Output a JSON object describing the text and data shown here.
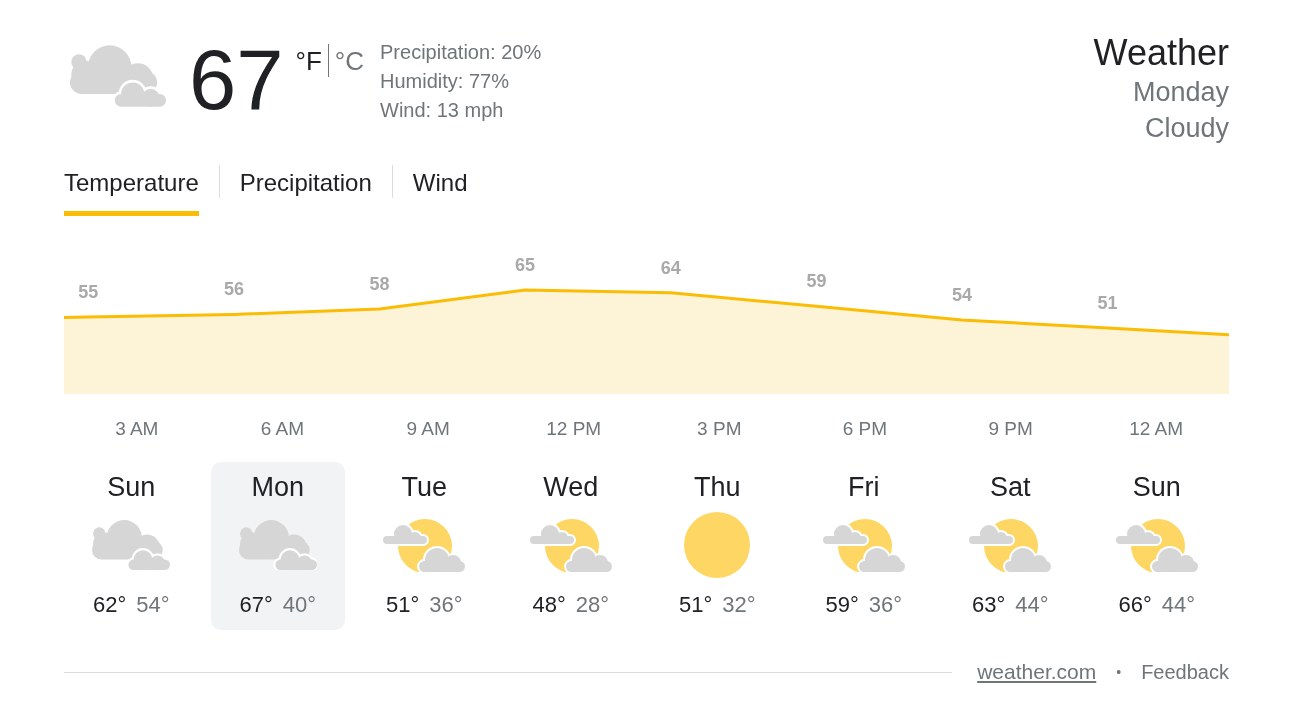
{
  "current": {
    "kind": "cloudy",
    "temperature": "67",
    "units": [
      {
        "label": "°F",
        "selected": true
      },
      {
        "label": "°C",
        "selected": false
      }
    ],
    "details": [
      "Precipitation: 20%",
      "Humidity: 77%",
      "Wind: 13 mph"
    ]
  },
  "summary": {
    "title": "Weather",
    "day": "Monday",
    "condition": "Cloudy"
  },
  "tabs": [
    {
      "label": "Temperature",
      "selected": true
    },
    {
      "label": "Precipitation",
      "selected": false
    },
    {
      "label": "Wind",
      "selected": false
    }
  ],
  "hourly": {
    "readings": [
      "55",
      "56",
      "58",
      "65",
      "64",
      "59",
      "54",
      "51"
    ],
    "times": [
      "3 AM",
      "6 AM",
      "9 AM",
      "12 PM",
      "3 PM",
      "6 PM",
      "9 PM",
      "12 AM"
    ]
  },
  "days": [
    {
      "day": "Sun",
      "kind": "cloudy",
      "high": "62°",
      "low": "54°",
      "selected": false
    },
    {
      "day": "Mon",
      "kind": "cloudy",
      "high": "67°",
      "low": "40°",
      "selected": true
    },
    {
      "day": "Tue",
      "kind": "partly_cloudy",
      "high": "51°",
      "low": "36°",
      "selected": false
    },
    {
      "day": "Wed",
      "kind": "partly_cloudy",
      "high": "48°",
      "low": "28°",
      "selected": false
    },
    {
      "day": "Thu",
      "kind": "sunny",
      "high": "51°",
      "low": "32°",
      "selected": false
    },
    {
      "day": "Fri",
      "kind": "partly_cloudy",
      "high": "59°",
      "low": "36°",
      "selected": false
    },
    {
      "day": "Sat",
      "kind": "partly_cloudy",
      "high": "63°",
      "low": "44°",
      "selected": false
    },
    {
      "day": "Sun",
      "kind": "partly_cloudy",
      "high": "66°",
      "low": "44°",
      "selected": false
    }
  ],
  "footer": {
    "source": "weather.com",
    "separator": "•",
    "feedback": "Feedback"
  }
}
